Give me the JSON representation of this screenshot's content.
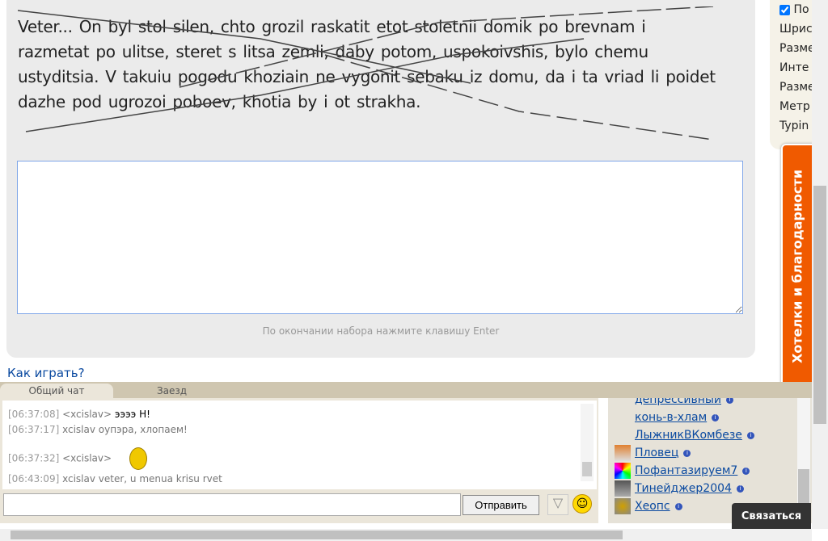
{
  "captcha": {
    "text": "Veter... On byl stol silen, chto grozil raskatit etot stoletnii domik po brevnam i razmetat po ulitse, steret s litsa zemli, daby potom, uspokoivshis, bylo chemu ustyditsia. V takuiu pogodu khoziain ne vygonit sebaku iz domu, da i ta vriad li poidet dazhe pod ugrozoi poboev, khotia by i ot strakha."
  },
  "typing": {
    "value": "",
    "hint": "По окончании набора нажмите клавишу Enter"
  },
  "how_to_play": "Как играть?",
  "settings": {
    "items": [
      "По",
      "Шрис",
      "Разме",
      "Инте",
      "Разме",
      "Метр",
      "Typin"
    ]
  },
  "feedback_tab": "Хотелки и благодарности",
  "chat": {
    "tabs": [
      "Общий чат",
      "Заезд"
    ],
    "messages": [
      {
        "time": "[06:37:08]",
        "user": "<xcislav>",
        "text": "ээээ Н!"
      },
      {
        "time": "[06:37:17]",
        "user": "xcislav",
        "text": "оупэра, хлопаем!"
      },
      {
        "time": "[06:37:32]",
        "user": "<xcislav>",
        "text": ""
      },
      {
        "time": "[06:43:09]",
        "user": "xcislav",
        "text": "veter, u menua krisu rvet"
      }
    ],
    "input_value": "",
    "send_label": "Отправить"
  },
  "users": [
    "депрессивный",
    "конь-в-хлам",
    "ЛыжникВКомбезе",
    "Пловец",
    "Пофантазируем7",
    "Тинейджер2004",
    "Хеопс"
  ],
  "contact_label": "Связаться"
}
